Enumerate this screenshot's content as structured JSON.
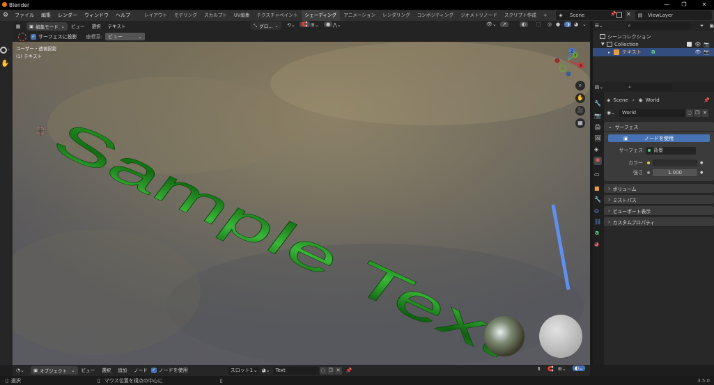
{
  "window": {
    "title": "Blender"
  },
  "menu": [
    "ファイル",
    "編集",
    "レンダー",
    "ウィンドウ",
    "ヘルプ"
  ],
  "workspaces": [
    "レイアウト",
    "モデリング",
    "スカルプト",
    "UV編集",
    "テクスチャペイント",
    "シェーディング",
    "アニメーション",
    "レンダリング",
    "コンポジティング",
    "ジオメトリノード",
    "スクリプト作成"
  ],
  "active_workspace": "シェーディング",
  "scene": "Scene",
  "viewlayer": "ViewLayer",
  "vp_header": {
    "mode": "編集モード",
    "items": [
      "ビュー",
      "選択",
      "テキスト"
    ],
    "transform": "グロ..."
  },
  "tool_header": {
    "surface_project": "サーフェスに投影",
    "orient_label": "座標系:",
    "orient_value": "ビュー"
  },
  "viewport": {
    "view_name": "ユーザー・透視投影",
    "object_name": "(1) テキスト",
    "text3d": "Sample Text"
  },
  "outliner": {
    "scene_collection": "シーンコレクション",
    "collection": "Collection",
    "object": "テキスト"
  },
  "props": {
    "breadcrumb_scene": "Scene",
    "breadcrumb_world": "World",
    "world_name": "World",
    "surface_panel": "サーフェス",
    "use_nodes": "ノードを使用",
    "surface_label": "サーフェス",
    "surface_value": "背景",
    "color_label": "カラー",
    "strength_label": "強さ",
    "strength_value": "1.000",
    "volume": "ボリューム",
    "mist": "ミストパス",
    "viewport_display": "ビューポート表示",
    "custom_props": "カスタムプロパティ"
  },
  "bottom": {
    "mode": "オブジェクト",
    "items": [
      "ビュー",
      "選択",
      "追加",
      "ノード"
    ],
    "use_nodes": "ノードを使用",
    "slot": "スロット1",
    "material": "Text"
  },
  "status": {
    "select": "選択",
    "center": "マウス位置を視点の中心に",
    "version": "3.5.0"
  },
  "colors": {
    "text3d": "#1f8a1f",
    "accent": "#4772b3",
    "cursor": "#5f8ff0"
  }
}
